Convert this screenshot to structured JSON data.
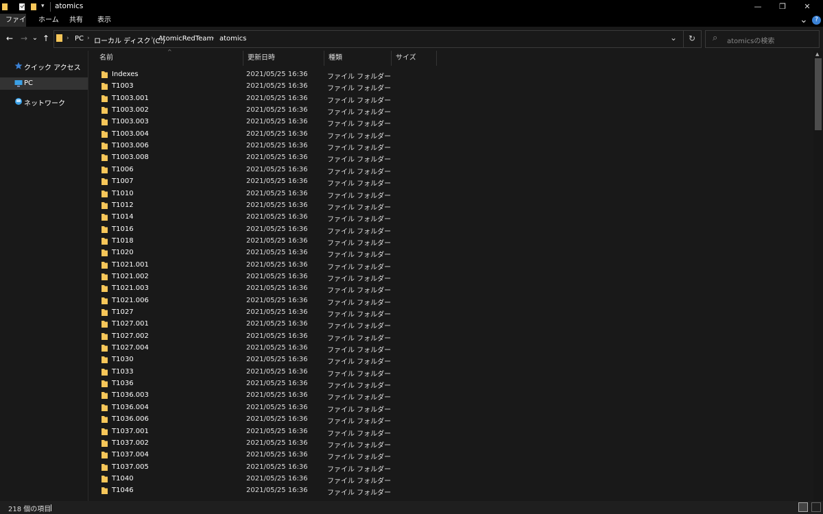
{
  "window": {
    "title": "atomics",
    "minimize_glyph": "—",
    "restore_glyph": "❐",
    "close_glyph": "✕"
  },
  "ribbon": {
    "tabs": [
      "ファイル",
      "ホーム",
      "共有",
      "表示"
    ],
    "expand_glyph": "⌄",
    "help_glyph": "?"
  },
  "nav": {
    "back_glyph": "←",
    "forward_glyph": "→",
    "recent_glyph": "⌄",
    "up_glyph": "↑"
  },
  "address": {
    "breadcrumbs": [
      "PC",
      "ローカル ディスク (C:)",
      "AtomicRedTeam",
      "atomics"
    ],
    "separator": "›",
    "dropdown_glyph": "⌄",
    "refresh_glyph": "↻"
  },
  "search": {
    "placeholder": "atomicsの検索",
    "icon_glyph": "⌕"
  },
  "sidebar": {
    "items": [
      {
        "label": "クイック アクセス",
        "icon": "star-icon"
      },
      {
        "label": "PC",
        "icon": "pc-icon"
      },
      {
        "label": "ネットワーク",
        "icon": "network-icon"
      }
    ]
  },
  "columns": {
    "name": "名前",
    "date": "更新日時",
    "type": "種類",
    "size": "サイズ"
  },
  "files": [
    {
      "name": "Indexes",
      "date": "2021/05/25 16:36",
      "type": "ファイル フォルダー"
    },
    {
      "name": "T1003",
      "date": "2021/05/25 16:36",
      "type": "ファイル フォルダー"
    },
    {
      "name": "T1003.001",
      "date": "2021/05/25 16:36",
      "type": "ファイル フォルダー"
    },
    {
      "name": "T1003.002",
      "date": "2021/05/25 16:36",
      "type": "ファイル フォルダー"
    },
    {
      "name": "T1003.003",
      "date": "2021/05/25 16:36",
      "type": "ファイル フォルダー"
    },
    {
      "name": "T1003.004",
      "date": "2021/05/25 16:36",
      "type": "ファイル フォルダー"
    },
    {
      "name": "T1003.006",
      "date": "2021/05/25 16:36",
      "type": "ファイル フォルダー"
    },
    {
      "name": "T1003.008",
      "date": "2021/05/25 16:36",
      "type": "ファイル フォルダー"
    },
    {
      "name": "T1006",
      "date": "2021/05/25 16:36",
      "type": "ファイル フォルダー"
    },
    {
      "name": "T1007",
      "date": "2021/05/25 16:36",
      "type": "ファイル フォルダー"
    },
    {
      "name": "T1010",
      "date": "2021/05/25 16:36",
      "type": "ファイル フォルダー"
    },
    {
      "name": "T1012",
      "date": "2021/05/25 16:36",
      "type": "ファイル フォルダー"
    },
    {
      "name": "T1014",
      "date": "2021/05/25 16:36",
      "type": "ファイル フォルダー"
    },
    {
      "name": "T1016",
      "date": "2021/05/25 16:36",
      "type": "ファイル フォルダー"
    },
    {
      "name": "T1018",
      "date": "2021/05/25 16:36",
      "type": "ファイル フォルダー"
    },
    {
      "name": "T1020",
      "date": "2021/05/25 16:36",
      "type": "ファイル フォルダー"
    },
    {
      "name": "T1021.001",
      "date": "2021/05/25 16:36",
      "type": "ファイル フォルダー"
    },
    {
      "name": "T1021.002",
      "date": "2021/05/25 16:36",
      "type": "ファイル フォルダー"
    },
    {
      "name": "T1021.003",
      "date": "2021/05/25 16:36",
      "type": "ファイル フォルダー"
    },
    {
      "name": "T1021.006",
      "date": "2021/05/25 16:36",
      "type": "ファイル フォルダー"
    },
    {
      "name": "T1027",
      "date": "2021/05/25 16:36",
      "type": "ファイル フォルダー"
    },
    {
      "name": "T1027.001",
      "date": "2021/05/25 16:36",
      "type": "ファイル フォルダー"
    },
    {
      "name": "T1027.002",
      "date": "2021/05/25 16:36",
      "type": "ファイル フォルダー"
    },
    {
      "name": "T1027.004",
      "date": "2021/05/25 16:36",
      "type": "ファイル フォルダー"
    },
    {
      "name": "T1030",
      "date": "2021/05/25 16:36",
      "type": "ファイル フォルダー"
    },
    {
      "name": "T1033",
      "date": "2021/05/25 16:36",
      "type": "ファイル フォルダー"
    },
    {
      "name": "T1036",
      "date": "2021/05/25 16:36",
      "type": "ファイル フォルダー"
    },
    {
      "name": "T1036.003",
      "date": "2021/05/25 16:36",
      "type": "ファイル フォルダー"
    },
    {
      "name": "T1036.004",
      "date": "2021/05/25 16:36",
      "type": "ファイル フォルダー"
    },
    {
      "name": "T1036.006",
      "date": "2021/05/25 16:36",
      "type": "ファイル フォルダー"
    },
    {
      "name": "T1037.001",
      "date": "2021/05/25 16:36",
      "type": "ファイル フォルダー"
    },
    {
      "name": "T1037.002",
      "date": "2021/05/25 16:36",
      "type": "ファイル フォルダー"
    },
    {
      "name": "T1037.004",
      "date": "2021/05/25 16:36",
      "type": "ファイル フォルダー"
    },
    {
      "name": "T1037.005",
      "date": "2021/05/25 16:36",
      "type": "ファイル フォルダー"
    },
    {
      "name": "T1040",
      "date": "2021/05/25 16:36",
      "type": "ファイル フォルダー"
    },
    {
      "name": "T1046",
      "date": "2021/05/25 16:36",
      "type": "ファイル フォルダー"
    }
  ],
  "status": {
    "item_count": "218 個の項目"
  },
  "colors": {
    "folder": "#f6c659",
    "accent": "#3b82d6",
    "background": "#191919"
  }
}
